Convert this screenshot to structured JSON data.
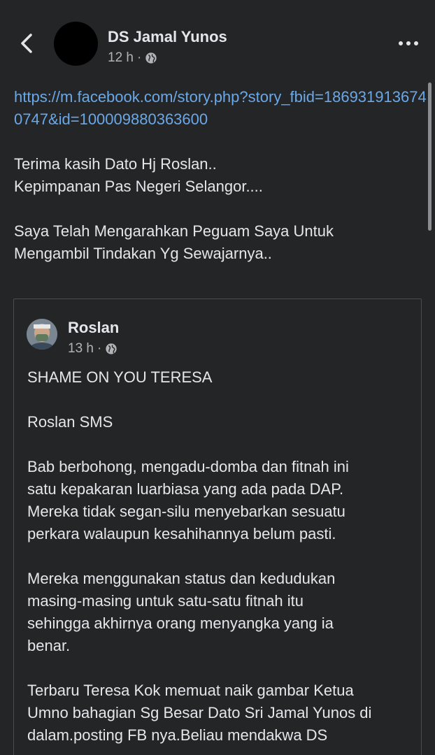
{
  "header": {
    "author_name": "DS Jamal Yunos",
    "timestamp": "12 h",
    "separator": "·",
    "privacy_icon": "globe-icon",
    "back_icon": "chevron-left-icon",
    "more_icon": "more-horizontal-icon"
  },
  "post": {
    "link": "https://m.facebook.com/story.php?story_fbid=1869319136740747&id=100009880363600",
    "paragraph_1": "Terima kasih Dato Hj Roslan..\nKepimpanan Pas Negeri Selangor....",
    "paragraph_2": "Saya Telah Mengarahkan Peguam Saya Untuk\nMengambil Tindakan Yg Sewajarnya.."
  },
  "shared_post": {
    "author_name": "Roslan",
    "timestamp": "13 h",
    "separator": "·",
    "privacy_icon": "globe-icon",
    "paragraphs": [
      "SHAME ON YOU TERESA",
      "Roslan SMS",
      "Bab berbohong, mengadu-domba dan fitnah ini\nsatu kepakaran luarbiasa yang ada pada DAP.\nMereka tidak segan-silu menyebarkan sesuatu\nperkara walaupun kesahihannya belum pasti.",
      "Mereka menggunakan status dan kedudukan\nmasing-masing untuk satu-satu fitnah itu\nsehingga akhirnya orang menyangka yang ia\nbenar.",
      "Terbaru Teresa Kok memuat naik gambar Ketua\nUmno bahagian Sg Besar Dato Sri Jamal Yunos di\ndalam.posting FB nya.Beliau mendakwa DS"
    ]
  },
  "colors": {
    "background": "#242526",
    "text": "#e4e6eb",
    "secondary_text": "#b0b3b8",
    "link": "#6aa8e8",
    "card_border": "#4a4c4f"
  }
}
